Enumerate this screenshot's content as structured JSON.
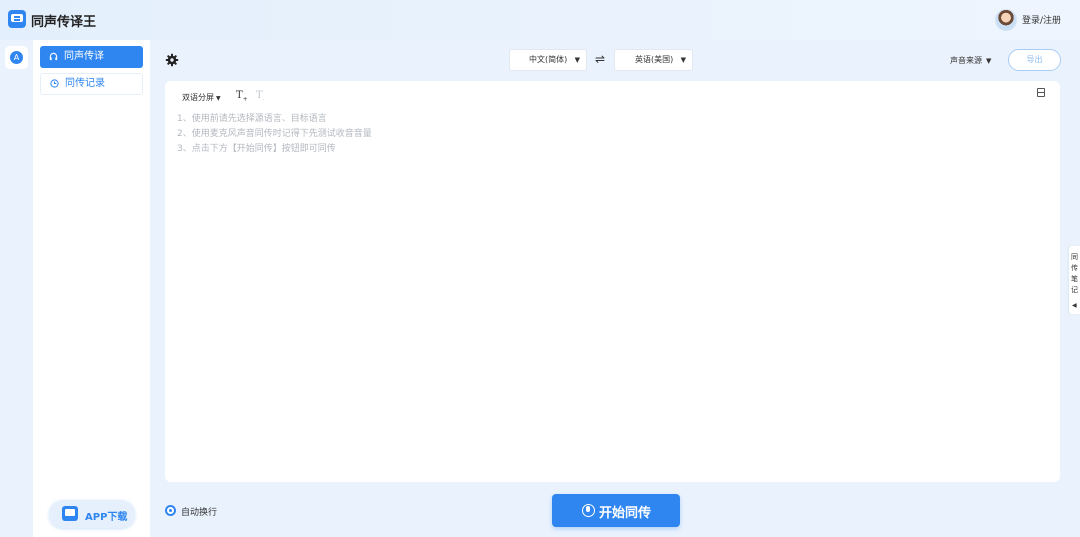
{
  "header": {
    "app_title": "同声传译王",
    "login_label": "登录/注册"
  },
  "rail": {
    "icon": "translate-icon",
    "glyph": "A"
  },
  "sidebar": {
    "items": [
      {
        "label": "同声传译",
        "icon": "headphones-icon",
        "active": true
      },
      {
        "label": "同传记录",
        "icon": "clock-icon",
        "active": false
      }
    ],
    "app_download_label": "APP下载"
  },
  "toolbar": {
    "settings_icon": "gear-icon",
    "source_language": "中文(简体)",
    "target_language": "英语(美国)",
    "swap_glyph": "⇌",
    "sound_source_label": "声音来源",
    "export_label": "导出"
  },
  "panel": {
    "display_mode": "双语分屏",
    "font_increase_icon": "font-increase-icon",
    "font_decrease_icon": "font-decrease-icon",
    "layout_icon": "layout-icon",
    "hints": [
      "1、使用前请先选择源语言、目标语言",
      "2、使用麦克风声音同传时记得下先测试收音音量",
      "3、点击下方【开始同传】按钮即可同传"
    ]
  },
  "side_tab": {
    "label": "同传笔记",
    "arrow_glyph": "◀"
  },
  "footer": {
    "auto_wrap_label": "自动换行",
    "auto_wrap_checked": true,
    "start_label": "开始同传"
  },
  "colors": {
    "accent": "#2f86f0",
    "background": "#eaf3fd",
    "hint_text": "#b3b8bf"
  }
}
